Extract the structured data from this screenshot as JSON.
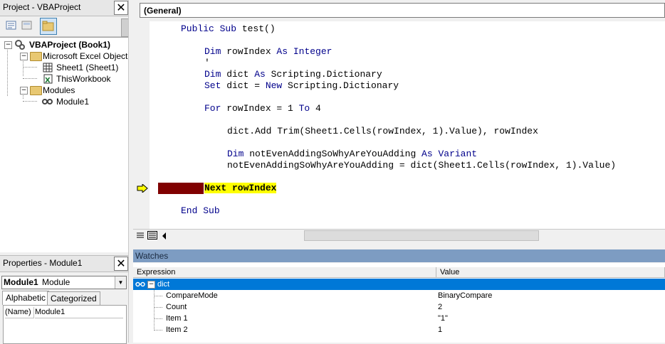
{
  "project_panel": {
    "title": "Project - VBAProject",
    "close": "✕",
    "tree": {
      "root": "VBAProject (Book1)",
      "excel_objects": "Microsoft Excel Objects",
      "sheet1": "Sheet1 (Sheet1)",
      "thisworkbook": "ThisWorkbook",
      "modules": "Modules",
      "module1": "Module1"
    }
  },
  "properties_panel": {
    "title": "Properties - Module1",
    "close": "✕",
    "selected_name": "Module1",
    "selected_type": "Module",
    "tab_alphabetic": "Alphabetic",
    "tab_categorized": "Categorized",
    "prop_name_key": "(Name)",
    "prop_name_value": "Module1"
  },
  "code_window": {
    "object_combo": "(General)",
    "lines": {
      "l1": "Public Sub test()",
      "l2": "Dim rowIndex As Integer",
      "l3": "'",
      "l4": "Dim dict As Scripting.Dictionary",
      "l5": "Set dict = New Scripting.Dictionary",
      "l6": "For rowIndex = 1 To 4",
      "l7": "dict.Add Trim(Sheet1.Cells(rowIndex, 1).Value), rowIndex",
      "l8": "Dim notEvenAddingSoWhyAreYouAdding As Variant",
      "l9": "notEvenAddingSoWhyAreYouAdding = dict(Sheet1.Cells(rowIndex, 1).Value)",
      "l10": "Next rowIndex",
      "l11": "End Sub"
    },
    "current_line": "Next rowIndex"
  },
  "watches": {
    "title": "Watches",
    "col_expression": "Expression",
    "col_value": "Value",
    "rows": [
      {
        "expr": "dict",
        "value": ""
      },
      {
        "expr": "CompareMode",
        "value": "BinaryCompare"
      },
      {
        "expr": "Count",
        "value": "2"
      },
      {
        "expr": "Item 1",
        "value": "\"1\""
      },
      {
        "expr": "Item 2",
        "value": "1"
      }
    ]
  },
  "colors": {
    "selection": "#0078d7",
    "current_line_highlight": "#ffff00",
    "breakpoint_bar": "#800000",
    "keyword": "#00008b"
  }
}
